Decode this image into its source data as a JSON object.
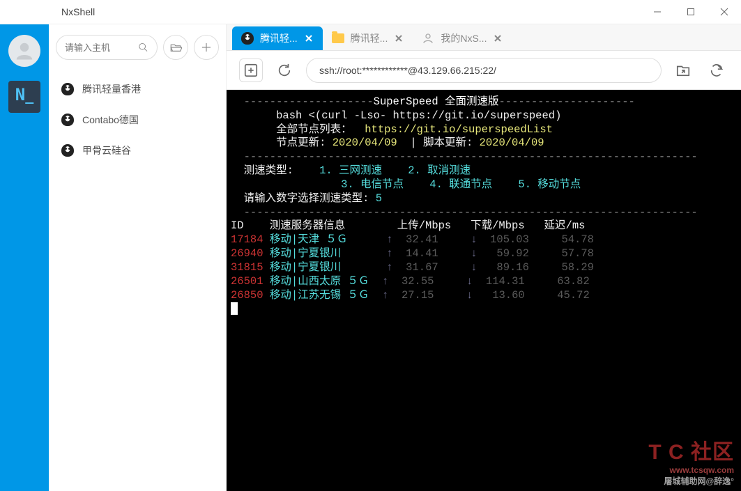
{
  "titlebar": {
    "title": "NxShell"
  },
  "sidebar": {
    "search_placeholder": "请输入主机",
    "hosts": [
      {
        "label": "腾讯轻量香港"
      },
      {
        "label": "Contabo德国"
      },
      {
        "label": "甲骨云硅谷"
      }
    ]
  },
  "tabs": [
    {
      "label": "腾讯轻...",
      "icon": "penguin",
      "active": true
    },
    {
      "label": "腾讯轻...",
      "icon": "folder",
      "active": false
    },
    {
      "label": "我的NxS...",
      "icon": "user",
      "active": false
    }
  ],
  "urlbar": {
    "value": "ssh://root:************@43.129.66.215:22/"
  },
  "terminal": {
    "dash_line": "------------------------------------------------------------------------",
    "title_prefix": "  --------------------",
    "title_text": "SuperSpeed 全面测速版",
    "title_suffix": "---------------------",
    "cmd_line": "       bash <(curl -Lso- https://git.io/superspeed)",
    "nodes_label": "       全部节点列表：  ",
    "nodes_url": "https://git.io/superspeedList",
    "update_lbl1": "       节点更新: ",
    "update_val1": "2020/04/09",
    "update_sep": "  | 脚本更新: ",
    "update_val2": "2020/04/09",
    "menu_label": "  测速类型:    ",
    "opt1": "1. 三网测速",
    "opt2": "2. 取消测速",
    "opt3": "3. 电信节点",
    "opt4": "4. 联通节点",
    "opt5": "5. 移动节点",
    "prompt_label": "  请输入数字选择测速类型: ",
    "prompt_value": "5",
    "header_id": "ID",
    "header_server": "测速服务器信息",
    "header_up": "上传/Mbps",
    "header_down": "下载/Mbps",
    "header_ping": "延迟/ms",
    "rows": [
      {
        "id": "17184",
        "server": "移动|天津 ５Ｇ      ",
        "up": "32.41",
        "down": "105.03",
        "ping": "54.78"
      },
      {
        "id": "26940",
        "server": "移动|宁夏银川       ",
        "up": "14.41",
        "down": "59.92",
        "ping": "57.78"
      },
      {
        "id": "31815",
        "server": "移动|宁夏银川       ",
        "up": "31.67",
        "down": "89.16",
        "ping": "58.29"
      },
      {
        "id": "26501",
        "server": "移动|山西太原 ５Ｇ  ",
        "up": "32.55",
        "down": "114.31",
        "ping": "63.82"
      },
      {
        "id": "26850",
        "server": "移动|江苏无锡 ５Ｇ  ",
        "up": "27.15",
        "down": "13.60",
        "ping": "45.72"
      }
    ]
  },
  "watermark": {
    "brand": "T C 社区",
    "url": "www.tcsqw.com",
    "sub": "屠城辅助网@辞逸°"
  }
}
